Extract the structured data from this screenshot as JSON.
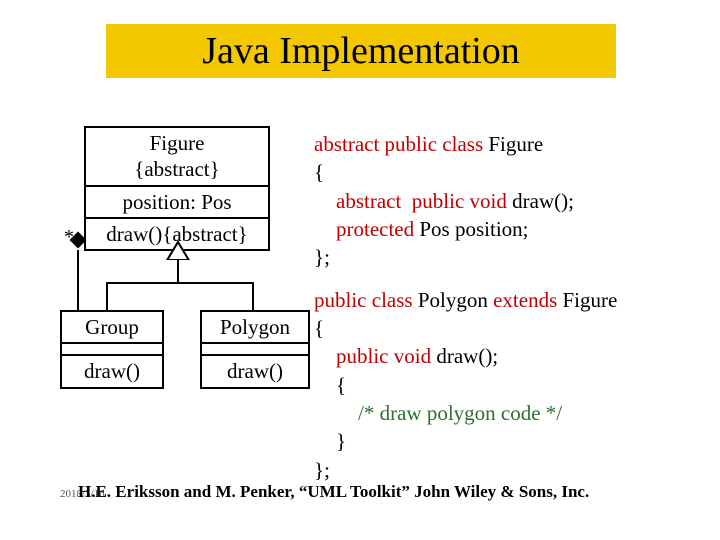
{
  "title": "Java Implementation",
  "uml": {
    "figure": {
      "name": "Figure",
      "stereotype": "{abstract}",
      "attr": "position: Pos",
      "op": "draw(){abstract}"
    },
    "group": {
      "name": "Group",
      "op": "draw()"
    },
    "polygon": {
      "name": "Polygon",
      "op": "draw()"
    },
    "multiplicity": "*"
  },
  "code": {
    "kw_abstract": "abstract",
    "kw_public": "public",
    "kw_class": "class",
    "kw_void": "void",
    "kw_protected": "protected",
    "kw_extends": "extends",
    "fig_name": "Figure",
    "poly_name": "Polygon",
    "draw_sig": "draw();",
    "pos_decl": "Pos position;",
    "comment": "/* draw polygon code */",
    "lbrace": "{",
    "rbrace": "}",
    "rbrace_semi": "};"
  },
  "footer": {
    "date": "2018/3/16",
    "citation": "H.E. Eriksson and M. Penker, “UML Toolkit” John Wiley & Sons, Inc."
  }
}
